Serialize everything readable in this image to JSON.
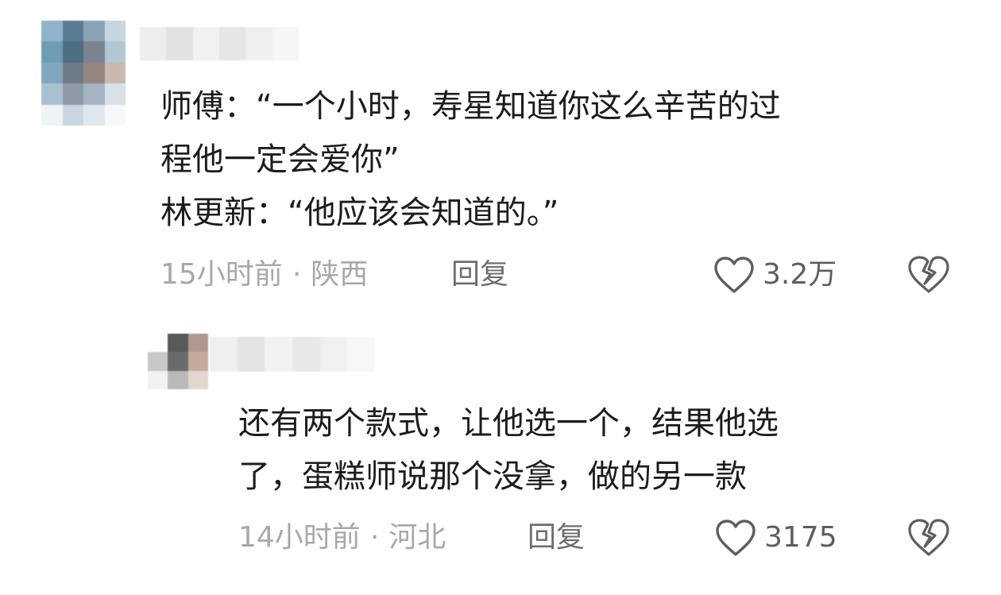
{
  "comments": [
    {
      "lines": [
        "师傅：“一个小时，寿星知道你这么辛苦的过",
        "程他一定会爱你”",
        "林更新：“他应该会知道的。”"
      ],
      "time": "15小时前",
      "separator": "·",
      "region": "陕西",
      "reply_label": "回复",
      "like_count": "3.2万"
    },
    {
      "lines": [
        "还有两个款式，让他选一个，结果他选",
        "了，蛋糕师说那个没拿，做的另一款"
      ],
      "time": "14小时前",
      "separator": "·",
      "region": "河北",
      "reply_label": "回复",
      "like_count": "3175"
    }
  ],
  "icons": {
    "like": "heart-outline-icon",
    "dislike": "broken-heart-icon",
    "avatar": "blurred-avatar",
    "username": "blurred-username"
  },
  "colors": {
    "text": "#1c1c1c",
    "meta": "#a8a8a8",
    "reply": "#6e6e6e",
    "icon": "#5e5e5e"
  }
}
